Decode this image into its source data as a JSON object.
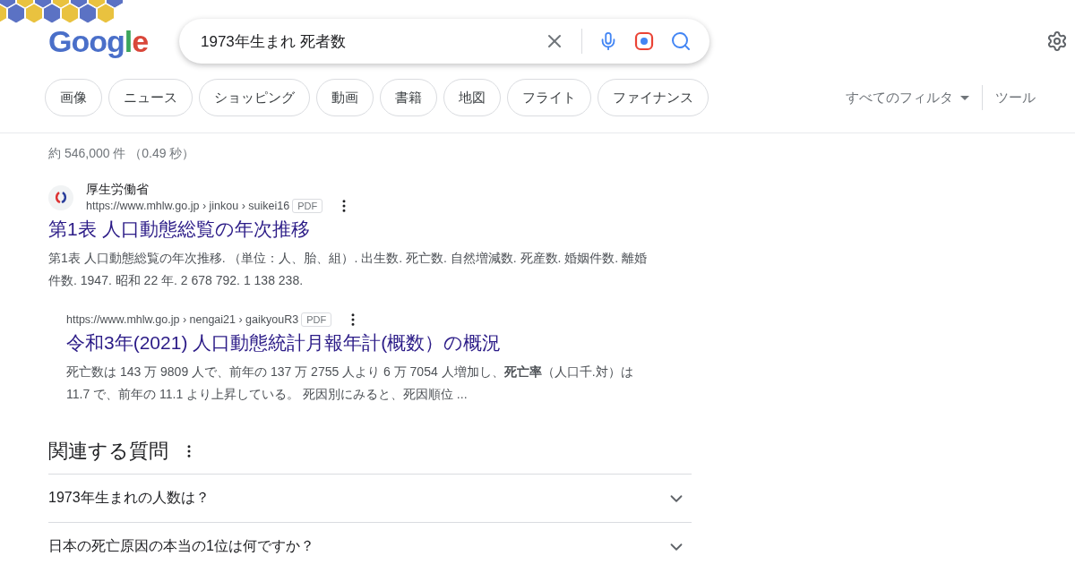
{
  "logo": "Google",
  "search": {
    "value": "1973年生まれ 死者数"
  },
  "filters": [
    {
      "label": "画像"
    },
    {
      "label": "ニュース"
    },
    {
      "label": "ショッピング"
    },
    {
      "label": "動画"
    },
    {
      "label": "書籍"
    },
    {
      "label": "地図"
    },
    {
      "label": "フライト"
    },
    {
      "label": "ファイナンス"
    }
  ],
  "all_filters": "すべてのフィルタ",
  "tools": "ツール",
  "result_stats": "約 546,000 件 （0.49 秒）",
  "results": [
    {
      "site": "厚生労働省",
      "url": "https://www.mhlw.go.jp › jinkou › suikei16",
      "file_type": "PDF",
      "title": "第1表 人口動態総覧の年次推移",
      "snippet": "第1表 人口動態総覧の年次推移. （単位：人、胎、組）. 出生数. 死亡数. 自然増減数. 死産数. 婚姻件数. 離婚件数. 1947. 昭和 22 年. 2 678 792. 1 138 238.",
      "sub": false
    },
    {
      "url": "https://www.mhlw.go.jp › nengai21 › gaikyouR3",
      "file_type": "PDF",
      "title": "令和3年(2021) 人口動態統計月報年計(概数）の概況",
      "snippet": "死亡数は 143 万 9809 人で、前年の 137 万 2755 人より 6 万 7054 人増加し、**死亡率**（人口千.対）は 11.7 で、前年の 11.1 より上昇している。 死因別にみると、死因順位 ...",
      "sub": true
    }
  ],
  "related": {
    "heading": "関連する質問",
    "questions": [
      {
        "text": "1973年生まれの人数は？",
        "expanded": false
      },
      {
        "text": "日本の死亡原因の本当の1位は何ですか？",
        "expanded": false
      }
    ]
  }
}
